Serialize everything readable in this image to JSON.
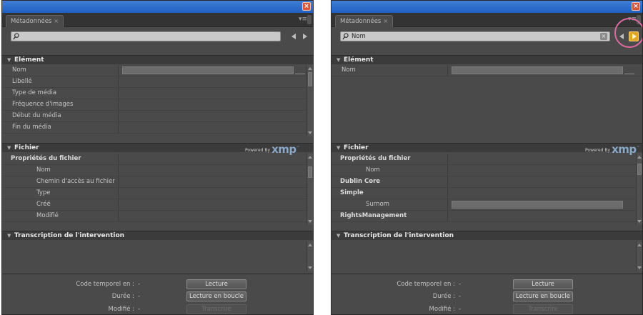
{
  "left": {
    "tab_label": "Métadonnées",
    "search": {
      "value": ""
    },
    "element": {
      "title": "Elément",
      "rows": [
        "Nom",
        "Libellé",
        "Type de média",
        "Fréquence d'images",
        "Début du média",
        "Fin du média"
      ]
    },
    "fichier": {
      "title": "Fichier",
      "rows": [
        {
          "label": "Propriétés du fichier",
          "bold": true
        },
        {
          "label": "Nom",
          "indent": true
        },
        {
          "label": "Chemin d'accès au fichier",
          "indent": true
        },
        {
          "label": "Type",
          "indent": true
        },
        {
          "label": "Créé",
          "indent": true
        },
        {
          "label": "Modifié",
          "indent": true
        }
      ]
    },
    "transcription": {
      "title": "Transcription de l'intervention"
    },
    "bottom": {
      "timecode_label": "Code temporel en :",
      "timecode_value": "-",
      "duration_label": "Durée :",
      "duration_value": "-",
      "modified_label": "Modifié :",
      "modified_value": "-",
      "play_button": "Lecture",
      "loop_button": "Lecture en boucle",
      "transcribe_button": "Transcrire"
    }
  },
  "right": {
    "tab_label": "Métadonnées",
    "search": {
      "value": "Nom"
    },
    "element": {
      "title": "Elément",
      "rows": [
        "Nom"
      ]
    },
    "fichier": {
      "title": "Fichier",
      "rows": [
        {
          "label": "Propriétés du fichier",
          "bold": true
        },
        {
          "label": "Nom",
          "indent": true
        },
        {
          "label": "Dublin Core",
          "bold": true
        },
        {
          "label": "Simple",
          "bold": true
        },
        {
          "label": "Surnom",
          "indent": true
        },
        {
          "label": "RightsManagement",
          "bold": true
        }
      ]
    },
    "transcription": {
      "title": "Transcription de l'intervention"
    },
    "bottom": {
      "timecode_label": "Code temporel en :",
      "timecode_value": "-",
      "duration_label": "Durée :",
      "duration_value": "-",
      "modified_label": "Modifié :",
      "modified_value": "-",
      "play_button": "Lecture",
      "loop_button": "Lecture en boucle",
      "transcribe_button": "Transcrire"
    }
  },
  "powered_by": "Powered By",
  "xmp_logo": "xmp",
  "colors": {
    "highlight_ring": "#d86aa0",
    "next_active": "#e6a520",
    "titlebar": "#2f6fd0"
  }
}
